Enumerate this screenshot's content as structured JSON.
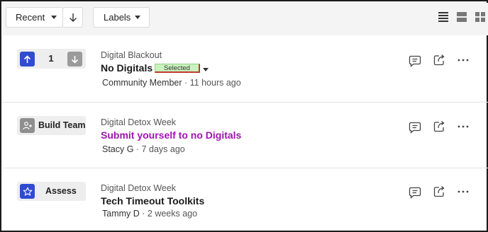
{
  "toolbar": {
    "sort_label": "Recent",
    "labels_label": "Labels",
    "views": [
      "list-view-icon",
      "card-view-icon",
      "grid-view-icon"
    ]
  },
  "posts": [
    {
      "category": "Digital Blackout",
      "title": "No Digitals",
      "status": "Selected",
      "author": "Community Member",
      "time": "· 11 hours ago",
      "votes": "1",
      "title_color": "#1a1a1a"
    },
    {
      "category": "Digital Detox Week",
      "title": "Submit yourself to no Digitals",
      "badge_label": "Build Team",
      "badge_icon": "build-team-icon",
      "author": "Stacy G",
      "time": "· 7 days ago",
      "title_color": "#a012b3"
    },
    {
      "category": "Digital Detox Week",
      "title": "Tech Timeout Toolkits",
      "badge_label": "Assess",
      "badge_icon": "star-icon",
      "author": "Tammy D",
      "time": "· 2 weeks ago",
      "title_color": "#1a1a1a"
    }
  ],
  "colors": {
    "vote_up": "#2f4bd1",
    "vote_down": "#9b9b9b",
    "status_bg": "#c9f2bf",
    "link": "#a012b3"
  }
}
